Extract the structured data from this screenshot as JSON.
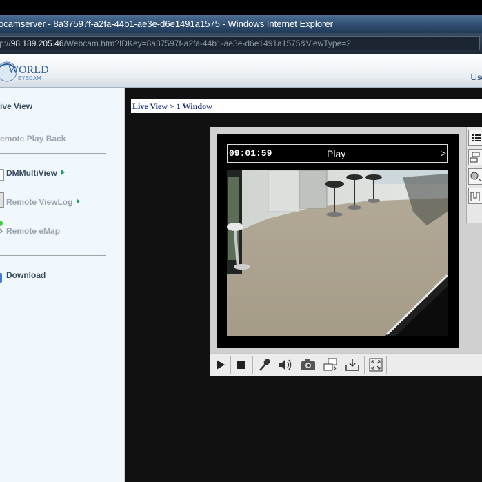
{
  "window": {
    "title": "ocamserver - 8a37597f-a2fa-44b1-ae3e-d6e1491a1575 - Windows Internet Explorer",
    "address_prefix": "p://",
    "address_host": "98.189.205.46",
    "address_path": "/Webcam.htm?IDKey=8a37597f-a2fa-44b1-ae3e-d6e1491a1575&ViewType=2"
  },
  "header": {
    "logo_line1": "WORLD",
    "logo_line2": "EYECAM",
    "user_label": "Use"
  },
  "sidebar": {
    "items": [
      {
        "label": "ive View"
      },
      {
        "label": "emote Play Back"
      },
      {
        "label": "DMMultiView"
      },
      {
        "label": "Remote ViewLog"
      },
      {
        "label": "Remote eMap"
      },
      {
        "label": "Download"
      }
    ]
  },
  "main": {
    "breadcrumb": "Live View > 1 Window"
  },
  "player": {
    "time": "09:01:59",
    "state": "Play",
    "next_symbol": ">"
  },
  "icons": {
    "play": "play-icon",
    "stop": "stop-icon",
    "mic": "microphone-icon",
    "speaker": "speaker-icon",
    "snapshot": "camera-icon",
    "switch": "switch-camera-icon",
    "save": "download-icon",
    "fullscreen": "fullscreen-icon"
  },
  "colors": {
    "titlebar": "#2c4a6c",
    "sidebar_bg": "#f1f8fd",
    "breadcrumb_text": "#1a2f7c",
    "menu_arrow": "#1ca56b"
  }
}
